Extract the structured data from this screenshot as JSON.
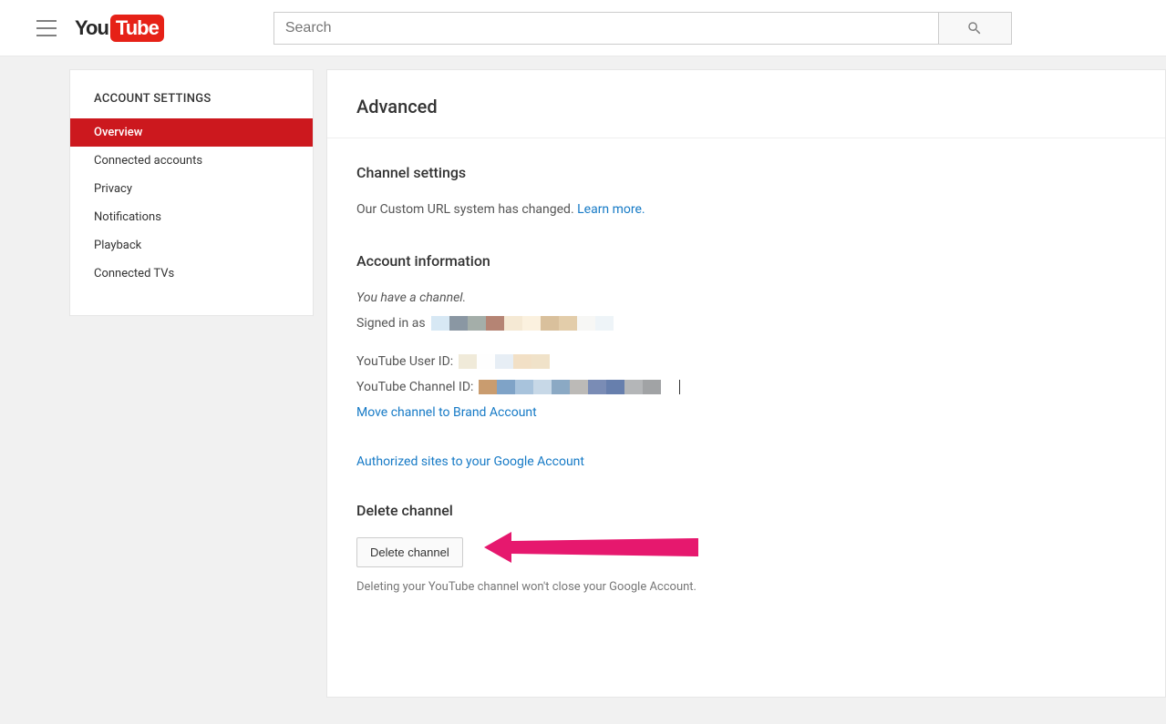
{
  "header": {
    "logo_you": "You",
    "logo_tube": "Tube",
    "search_placeholder": "Search"
  },
  "sidebar": {
    "title": "ACCOUNT SETTINGS",
    "items": [
      {
        "label": "Overview",
        "active": true
      },
      {
        "label": "Connected accounts",
        "active": false
      },
      {
        "label": "Privacy",
        "active": false
      },
      {
        "label": "Notifications",
        "active": false
      },
      {
        "label": "Playback",
        "active": false
      },
      {
        "label": "Connected TVs",
        "active": false
      }
    ]
  },
  "main": {
    "page_title": "Advanced",
    "channel_settings": {
      "title": "Channel settings",
      "text": "Our Custom URL system has changed. ",
      "link": "Learn more."
    },
    "account_info": {
      "title": "Account information",
      "has_channel": "You have a channel.",
      "signed_in_label": "Signed in as",
      "user_id_label": "YouTube User ID:",
      "channel_id_label": "YouTube Channel ID:",
      "move_link": "Move channel to Brand Account",
      "authorized_link": "Authorized sites to your Google Account"
    },
    "delete": {
      "title": "Delete channel",
      "button": "Delete channel",
      "disclaimer": "Deleting your YouTube channel won't close your Google Account."
    }
  }
}
